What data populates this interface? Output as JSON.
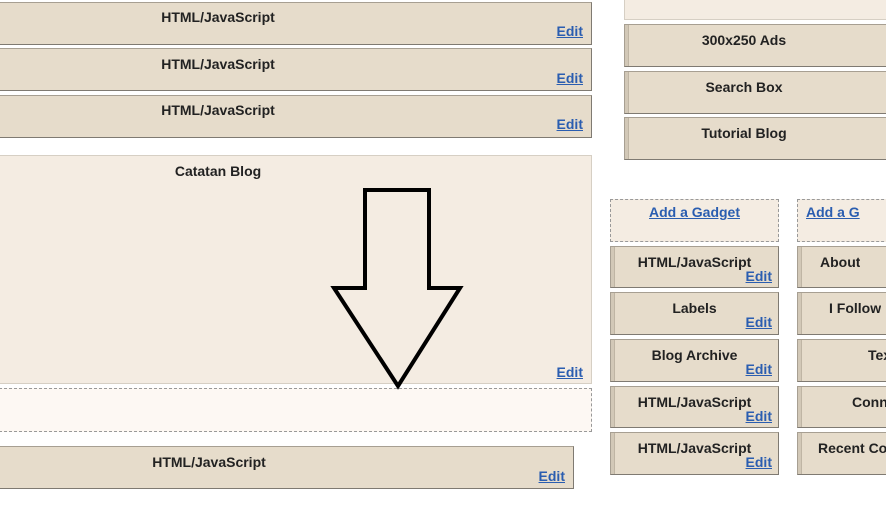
{
  "main_column": {
    "gadgets_top": [
      {
        "title": "HTML/JavaScript",
        "edit": "Edit"
      },
      {
        "title": "HTML/JavaScript",
        "edit": "Edit"
      },
      {
        "title": "HTML/JavaScript",
        "edit": "Edit"
      }
    ],
    "blog_posts": {
      "title": "Catatan Blog",
      "edit": "Edit"
    },
    "gadget_bottom": {
      "title": "HTML/JavaScript",
      "edit": "Edit"
    }
  },
  "right_top_column": {
    "gadgets": [
      {
        "title": "300x250 Ads"
      },
      {
        "title": "Search Box"
      },
      {
        "title": "Tutorial Blog"
      }
    ]
  },
  "sidebar_left": {
    "add_gadget": "Add a Gadget",
    "gadgets": [
      {
        "title": "HTML/JavaScript",
        "edit": "Edit"
      },
      {
        "title": "Labels",
        "edit": "Edit"
      },
      {
        "title": "Blog Archive",
        "edit": "Edit"
      },
      {
        "title": "HTML/JavaScript",
        "edit": "Edit"
      },
      {
        "title": "HTML/JavaScript",
        "edit": "Edit"
      }
    ]
  },
  "sidebar_right": {
    "add_gadget": "Add a G",
    "gadgets": [
      {
        "title": "About"
      },
      {
        "title": "I Follow"
      },
      {
        "title": "Tex"
      },
      {
        "title": "Conn"
      },
      {
        "title": "Recent Co"
      }
    ]
  },
  "annotation": {
    "icon": "down-arrow-icon"
  }
}
